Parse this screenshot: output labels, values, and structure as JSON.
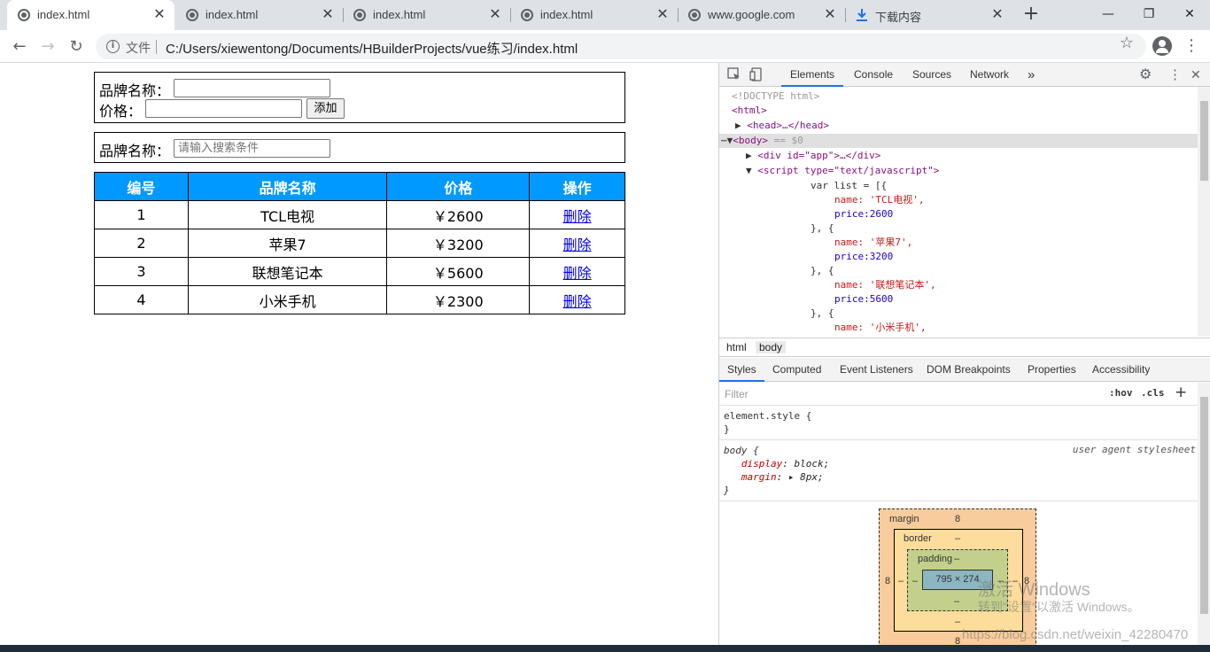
{
  "browser": {
    "tabs": [
      {
        "title": "index.html",
        "icon": "globe-icon",
        "active": true
      },
      {
        "title": "index.html",
        "icon": "globe-icon",
        "active": false
      },
      {
        "title": "index.html",
        "icon": "globe-icon",
        "active": false
      },
      {
        "title": "index.html",
        "icon": "globe-icon",
        "active": false
      },
      {
        "title": "www.google.com",
        "icon": "globe-icon",
        "active": false
      },
      {
        "title": "下载内容",
        "icon": "download-icon",
        "active": false
      }
    ],
    "new_tab": "+",
    "window": {
      "minimize": "—",
      "maximize": "❐",
      "close": "✕"
    },
    "omnibox": {
      "label": "文件",
      "url": "C:/Users/xiewentong/Documents/HBuilderProjects/vue练习/index.html"
    }
  },
  "page": {
    "form": {
      "brand_label": "品牌名称：",
      "brand_value": "",
      "price_label": "价格：",
      "price_value": "",
      "add_button": "添加"
    },
    "search": {
      "label": "品牌名称：",
      "placeholder": "请输入搜索条件"
    },
    "table": {
      "headers": [
        "编号",
        "品牌名称",
        "价格",
        "操作"
      ],
      "rows": [
        {
          "id": "1",
          "name": "TCL电视",
          "price": "￥2600",
          "action": "删除"
        },
        {
          "id": "2",
          "name": "苹果7",
          "price": "￥3200",
          "action": "删除"
        },
        {
          "id": "3",
          "name": "联想笔记本",
          "price": "￥5600",
          "action": "删除"
        },
        {
          "id": "4",
          "name": "小米手机",
          "price": "￥2300",
          "action": "删除"
        }
      ],
      "header_color": "#0099ff"
    }
  },
  "devtools": {
    "tabs": [
      "Elements",
      "Console",
      "Sources",
      "Network",
      "»"
    ],
    "code": {
      "doctype": "<!DOCTYPE html>",
      "html_open": "<html>",
      "head": "<head>…</head>",
      "body": "<body>",
      "body_suffix": " == $0",
      "div_app": "<div id=\"app\">…</div>",
      "script_open": "<script type=\"text/javascript\">",
      "l_var": "var list = [{",
      "l_name1": "name: 'TCL电视',",
      "l_price1": "price:2600",
      "l_close": "}, {",
      "l_name2": "name: '苹果7',",
      "l_price2": "price:3200",
      "l_name3": "name: '联想笔记本',",
      "l_price3": "price:5600",
      "l_name4": "name: '小米手机',"
    },
    "breadcrumbs": [
      "html",
      "body"
    ],
    "styles_tabs": [
      "Styles",
      "Computed",
      "Event Listeners",
      "DOM Breakpoints",
      "Properties",
      "Accessibility"
    ],
    "filter_placeholder": "Filter",
    "hov": ":hov",
    "cls": ".cls",
    "add": "+",
    "element_style": "element.style {",
    "brace_close": "}",
    "body_rule": "body {",
    "ua_label": "user agent stylesheet",
    "display_prop": "display",
    "display_val": "block;",
    "margin_prop": "margin",
    "margin_val": "8px;",
    "boxmodel": {
      "margin_label": "margin",
      "margin_top": "8",
      "margin_left": "8",
      "margin_right": "8",
      "margin_bottom": "8",
      "border_label": "border",
      "border_val": "–",
      "padding_label": "padding",
      "padding_val": "–",
      "content": "795 × 274"
    }
  },
  "watermark": {
    "line1": "激活 Windows",
    "line2": "转到\"设置\"以激活 Windows。",
    "url": "https://blog.csdn.net/weixin_42280470"
  }
}
